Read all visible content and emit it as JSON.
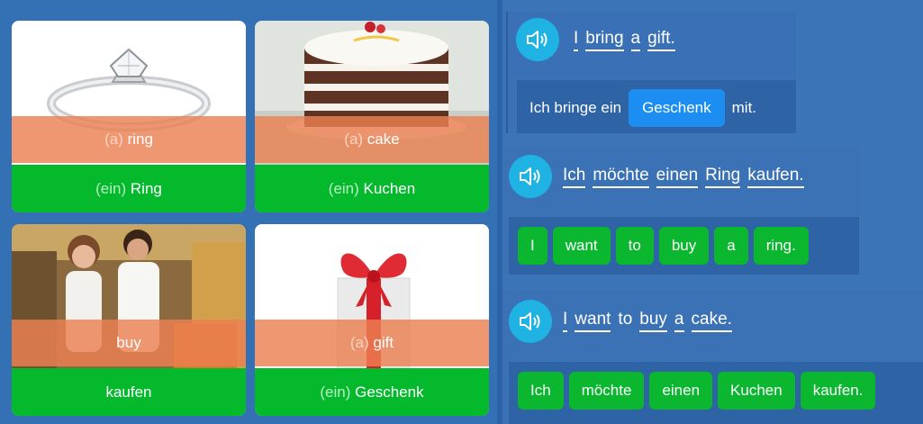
{
  "cards": [
    {
      "overlay_article": "(a)",
      "overlay_word": "ring",
      "footer_article": "(ein)",
      "footer_word": "Ring",
      "image": "ring-photo"
    },
    {
      "overlay_article": "(a)",
      "overlay_word": "cake",
      "footer_article": "(ein)",
      "footer_word": "Kuchen",
      "image": "cake-photo"
    },
    {
      "overlay_article": "",
      "overlay_word": "buy",
      "footer_article": "",
      "footer_word": "kaufen",
      "image": "couple-shopping-photo"
    },
    {
      "overlay_article": "(a)",
      "overlay_word": "gift",
      "footer_article": "(ein)",
      "footer_word": "Geschenk",
      "image": "gift-box-photo"
    }
  ],
  "exercises": [
    {
      "sentence": [
        "I",
        "bring",
        "a",
        "gift."
      ],
      "answer_prefix": "Ich bringe ein",
      "answer_chip": "Geschenk",
      "answer_suffix": "mit."
    },
    {
      "sentence": [
        "Ich",
        "möchte",
        "einen",
        "Ring",
        "kaufen."
      ],
      "chips": [
        "I",
        "want",
        "to",
        "buy",
        "a",
        "ring."
      ]
    },
    {
      "sentence": [
        "I",
        "want",
        "to",
        "buy",
        "a",
        "cake."
      ],
      "chips": [
        "Ich",
        "möchte",
        "einen",
        "Kuchen",
        "kaufen."
      ]
    }
  ],
  "colors": {
    "card_footer": "#05b92d",
    "overlay": "#ec8052",
    "speaker": "#1eb3e3",
    "chip": "#0ab72f",
    "answer_chip": "#1c8ef1"
  }
}
